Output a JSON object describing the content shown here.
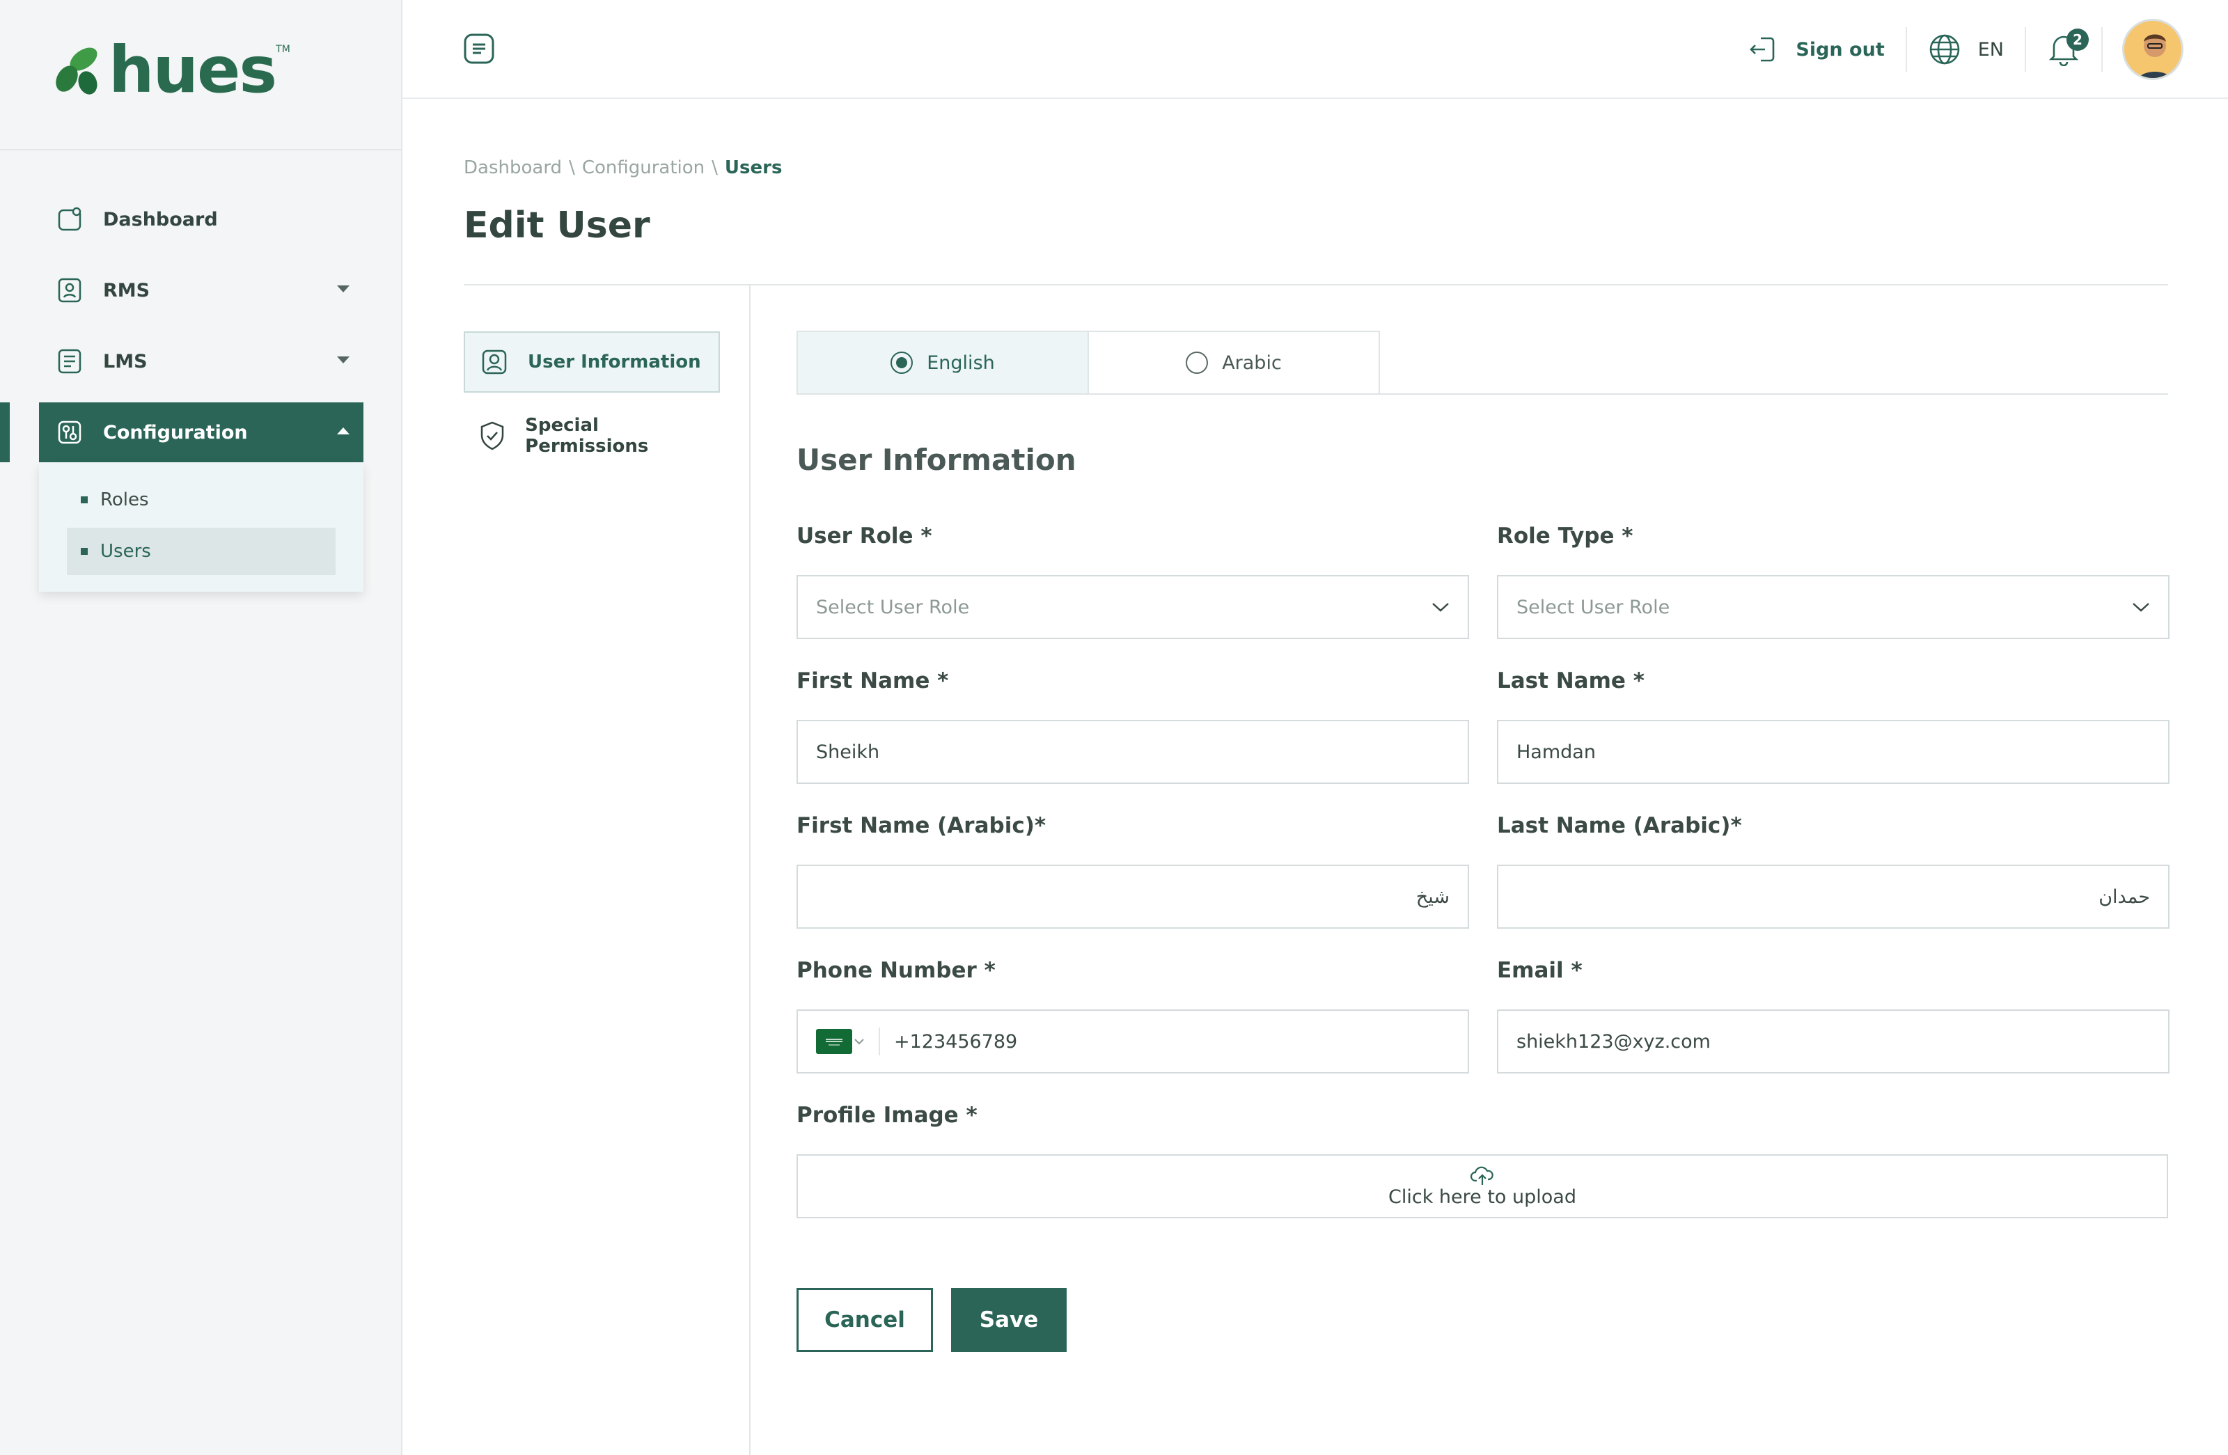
{
  "brand": {
    "name": "hues",
    "tm": "TM",
    "accent": "#2a6557",
    "logo_green": "#2a6b50"
  },
  "sidebar": {
    "items": [
      {
        "label": "Dashboard",
        "icon": "dashboard-icon"
      },
      {
        "label": "RMS",
        "icon": "rms-icon"
      },
      {
        "label": "LMS",
        "icon": "lms-icon"
      },
      {
        "label": "Configuration",
        "icon": "configuration-icon"
      }
    ],
    "submenu": [
      {
        "label": "Roles"
      },
      {
        "label": "Users"
      }
    ]
  },
  "header": {
    "signout_label": "Sign out",
    "language": "EN",
    "notification_count": "2"
  },
  "breadcrumb": [
    "Dashboard",
    "Configuration",
    "Users"
  ],
  "breadcrumb_sep": "\\",
  "page_title": "Edit User",
  "left_panel": [
    {
      "label": "User Information",
      "icon": "user-icon"
    },
    {
      "label": "Special Permissions",
      "icon": "shield-check-icon"
    }
  ],
  "lang_tabs": [
    {
      "label": "English",
      "selected": true
    },
    {
      "label": "Arabic",
      "selected": false
    }
  ],
  "section_title": "User Information",
  "form": {
    "user_role": {
      "label": "User Role *",
      "placeholder": "Select User Role"
    },
    "role_type": {
      "label": "Role Type *",
      "placeholder": "Select User Role"
    },
    "first_name": {
      "label": "First Name *",
      "value": "Sheikh"
    },
    "last_name": {
      "label": "Last Name *",
      "value": "Hamdan"
    },
    "first_name_ar": {
      "label": "First Name (Arabic)*",
      "value": "شيخ"
    },
    "last_name_ar": {
      "label": "Last Name (Arabic)*",
      "value": "حمدان"
    },
    "phone": {
      "label": "Phone Number *",
      "value": "+123456789",
      "country_icon": "saudi-flag-icon"
    },
    "email": {
      "label": "Email *",
      "value": "shiekh123@xyz.com"
    },
    "profile_image": {
      "label": "Profile Image *",
      "upload_text": "Click here to upload"
    }
  },
  "actions": {
    "cancel": "Cancel",
    "save": "Save"
  }
}
